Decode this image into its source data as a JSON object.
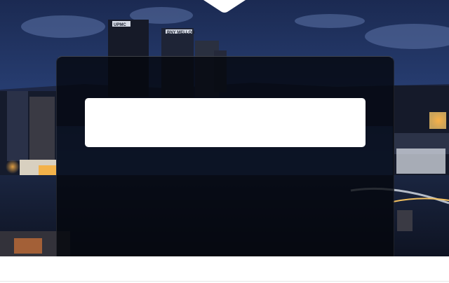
{
  "background_photo": {
    "building_signs": {
      "left_tower": "UPMC",
      "center_tower": "BNY MELLON"
    }
  },
  "panel": {
    "field_value": "",
    "field_placeholder": ""
  },
  "colors": {
    "sky_top": "#1b2a52",
    "sky_bottom": "#2f4a86",
    "panel_overlay": "#04060c",
    "field_background": "#ffffff"
  },
  "icons": {
    "top_notch": "chevron-down-icon"
  }
}
